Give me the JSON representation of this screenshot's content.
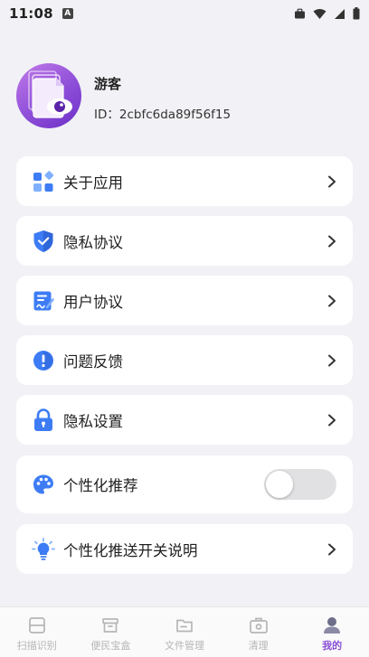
{
  "status_bar": {
    "time": "11:08",
    "notif_letter": "A"
  },
  "profile": {
    "name": "游客",
    "id_text": "ID：2cbfc6da89f56f15"
  },
  "menu": {
    "about": "关于应用",
    "privacy_policy": "隐私协议",
    "user_agreement": "用户协议",
    "feedback": "问题反馈",
    "privacy_settings": "隐私设置",
    "personalized": "个性化推荐",
    "personalized_push_info": "个性化推送开关说明"
  },
  "toggle_personalized": {
    "state": "off"
  },
  "nav": {
    "scan": "扫描识别",
    "toolbox": "便民宝盒",
    "files": "文件管理",
    "clean": "清理",
    "mine": "我的"
  },
  "colors": {
    "accent": "#8a4fd6",
    "icon_blue": "#3d7cf4",
    "background": "#f2f2f6"
  }
}
